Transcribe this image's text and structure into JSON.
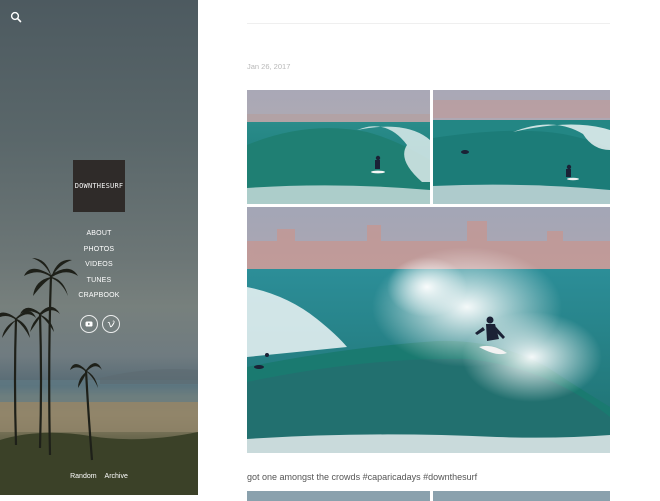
{
  "sidebar": {
    "logo_text": "DOWNTHESURF",
    "nav": [
      "ABOUT",
      "PHOTOS",
      "VIDEOS",
      "TUNES",
      "CRAPBOOK"
    ],
    "footer": {
      "random": "Random",
      "archive": "Archive"
    },
    "icons": [
      "search-icon",
      "youtube-icon",
      "vimeo-icon"
    ]
  },
  "post": {
    "date": "Jan 26, 2017",
    "caption": "got one amongst the crowds #caparicadays #downthesurf"
  },
  "colors": {
    "sea": "#1f8a8e",
    "sky": "#a8a9b6",
    "sidebar_top": "#4d5a60"
  }
}
